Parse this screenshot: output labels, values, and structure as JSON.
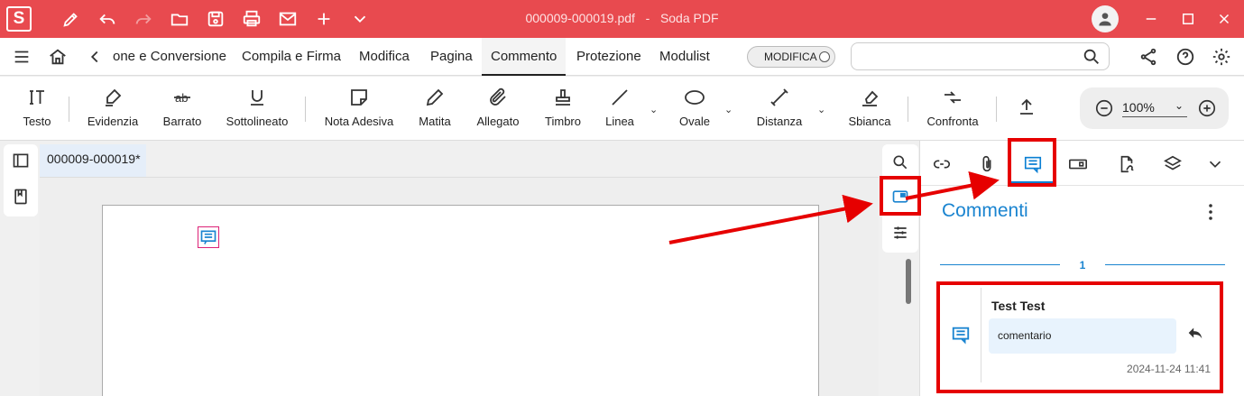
{
  "window": {
    "app_icon_letter": "S",
    "file_name": "000009-000019.pdf",
    "separator": "-",
    "app_name": "Soda PDF"
  },
  "menu": {
    "items": [
      "one e Conversione",
      "Compila e Firma",
      "Modifica",
      "Pagina",
      "Commento",
      "Protezione",
      "Modulist"
    ],
    "active": "Commento",
    "mode_toggle_label": "MODIFICA",
    "search_value": ""
  },
  "ribbon": {
    "tools": [
      "Testo",
      "Evidenzia",
      "Barrato",
      "Sottolineato",
      "Nota Adesiva",
      "Matita",
      "Allegato",
      "Timbro",
      "Linea",
      "Ovale",
      "Distanza",
      "Sbianca",
      "Confronta"
    ],
    "zoom_value": "100%"
  },
  "document": {
    "tab_title": "000009-000019*"
  },
  "panel": {
    "title": "Commenti",
    "page_number": "1",
    "comment": {
      "author": "Test Test",
      "text": "comentario",
      "timestamp": "2024-11-24 11:41"
    }
  },
  "colors": {
    "brand": "#e84a4f",
    "accent": "#1a84d0",
    "highlight": "#e60000"
  }
}
